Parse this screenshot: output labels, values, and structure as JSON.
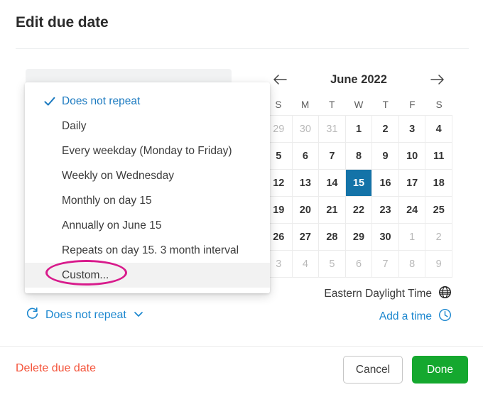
{
  "dialog": {
    "title": "Edit due date"
  },
  "repeat_menu": {
    "items": [
      {
        "label": "Does not repeat",
        "selected": true,
        "hovered": false
      },
      {
        "label": "Daily",
        "selected": false,
        "hovered": false
      },
      {
        "label": "Every weekday (Monday to Friday)",
        "selected": false,
        "hovered": false
      },
      {
        "label": "Weekly on Wednesday",
        "selected": false,
        "hovered": false
      },
      {
        "label": "Monthly on day 15",
        "selected": false,
        "hovered": false
      },
      {
        "label": "Annually on June 15",
        "selected": false,
        "hovered": false
      },
      {
        "label": "Repeats on day 15. 3 month interval",
        "selected": false,
        "hovered": false
      },
      {
        "label": "Custom...",
        "selected": false,
        "hovered": true
      }
    ],
    "check_icon": "check-icon",
    "annotation_color": "#d81b8c",
    "annotated_item": "Custom..."
  },
  "repeat_summary": {
    "icon": "repeat-icon",
    "label": "Does not repeat",
    "chevron": "chevron-down-icon"
  },
  "calendar": {
    "prev_icon": "arrow-left-icon",
    "next_icon": "arrow-right-icon",
    "month_label": "June 2022",
    "day_initials": [
      "S",
      "M",
      "T",
      "W",
      "T",
      "F",
      "S"
    ],
    "selected_day": 15,
    "selected_color": "#1473a8",
    "weeks": [
      [
        {
          "n": "29",
          "muted": true,
          "selected": false
        },
        {
          "n": "30",
          "muted": true,
          "selected": false
        },
        {
          "n": "31",
          "muted": true,
          "selected": false
        },
        {
          "n": "1",
          "muted": false,
          "selected": false
        },
        {
          "n": "2",
          "muted": false,
          "selected": false
        },
        {
          "n": "3",
          "muted": false,
          "selected": false
        },
        {
          "n": "4",
          "muted": false,
          "selected": false
        }
      ],
      [
        {
          "n": "5",
          "muted": false,
          "selected": false
        },
        {
          "n": "6",
          "muted": false,
          "selected": false
        },
        {
          "n": "7",
          "muted": false,
          "selected": false
        },
        {
          "n": "8",
          "muted": false,
          "selected": false
        },
        {
          "n": "9",
          "muted": false,
          "selected": false
        },
        {
          "n": "10",
          "muted": false,
          "selected": false
        },
        {
          "n": "11",
          "muted": false,
          "selected": false
        }
      ],
      [
        {
          "n": "12",
          "muted": false,
          "selected": false
        },
        {
          "n": "13",
          "muted": false,
          "selected": false
        },
        {
          "n": "14",
          "muted": false,
          "selected": false
        },
        {
          "n": "15",
          "muted": false,
          "selected": true
        },
        {
          "n": "16",
          "muted": false,
          "selected": false
        },
        {
          "n": "17",
          "muted": false,
          "selected": false
        },
        {
          "n": "18",
          "muted": false,
          "selected": false
        }
      ],
      [
        {
          "n": "19",
          "muted": false,
          "selected": false
        },
        {
          "n": "20",
          "muted": false,
          "selected": false
        },
        {
          "n": "21",
          "muted": false,
          "selected": false
        },
        {
          "n": "22",
          "muted": false,
          "selected": false
        },
        {
          "n": "23",
          "muted": false,
          "selected": false
        },
        {
          "n": "24",
          "muted": false,
          "selected": false
        },
        {
          "n": "25",
          "muted": false,
          "selected": false
        }
      ],
      [
        {
          "n": "26",
          "muted": false,
          "selected": false
        },
        {
          "n": "27",
          "muted": false,
          "selected": false
        },
        {
          "n": "28",
          "muted": false,
          "selected": false
        },
        {
          "n": "29",
          "muted": false,
          "selected": false
        },
        {
          "n": "30",
          "muted": false,
          "selected": false
        },
        {
          "n": "1",
          "muted": true,
          "selected": false
        },
        {
          "n": "2",
          "muted": true,
          "selected": false
        }
      ],
      [
        {
          "n": "3",
          "muted": true,
          "selected": false
        },
        {
          "n": "4",
          "muted": true,
          "selected": false
        },
        {
          "n": "5",
          "muted": true,
          "selected": false
        },
        {
          "n": "6",
          "muted": true,
          "selected": false
        },
        {
          "n": "7",
          "muted": true,
          "selected": false
        },
        {
          "n": "8",
          "muted": true,
          "selected": false
        },
        {
          "n": "9",
          "muted": true,
          "selected": false
        }
      ]
    ]
  },
  "timezone": {
    "label": "Eastern Daylight Time",
    "icon": "globe-icon"
  },
  "add_time": {
    "label": "Add a time",
    "icon": "clock-icon"
  },
  "footer": {
    "delete_label": "Delete due date",
    "delete_color": "#f4533a",
    "cancel_label": "Cancel",
    "done_label": "Done",
    "done_color": "#15a82f"
  }
}
